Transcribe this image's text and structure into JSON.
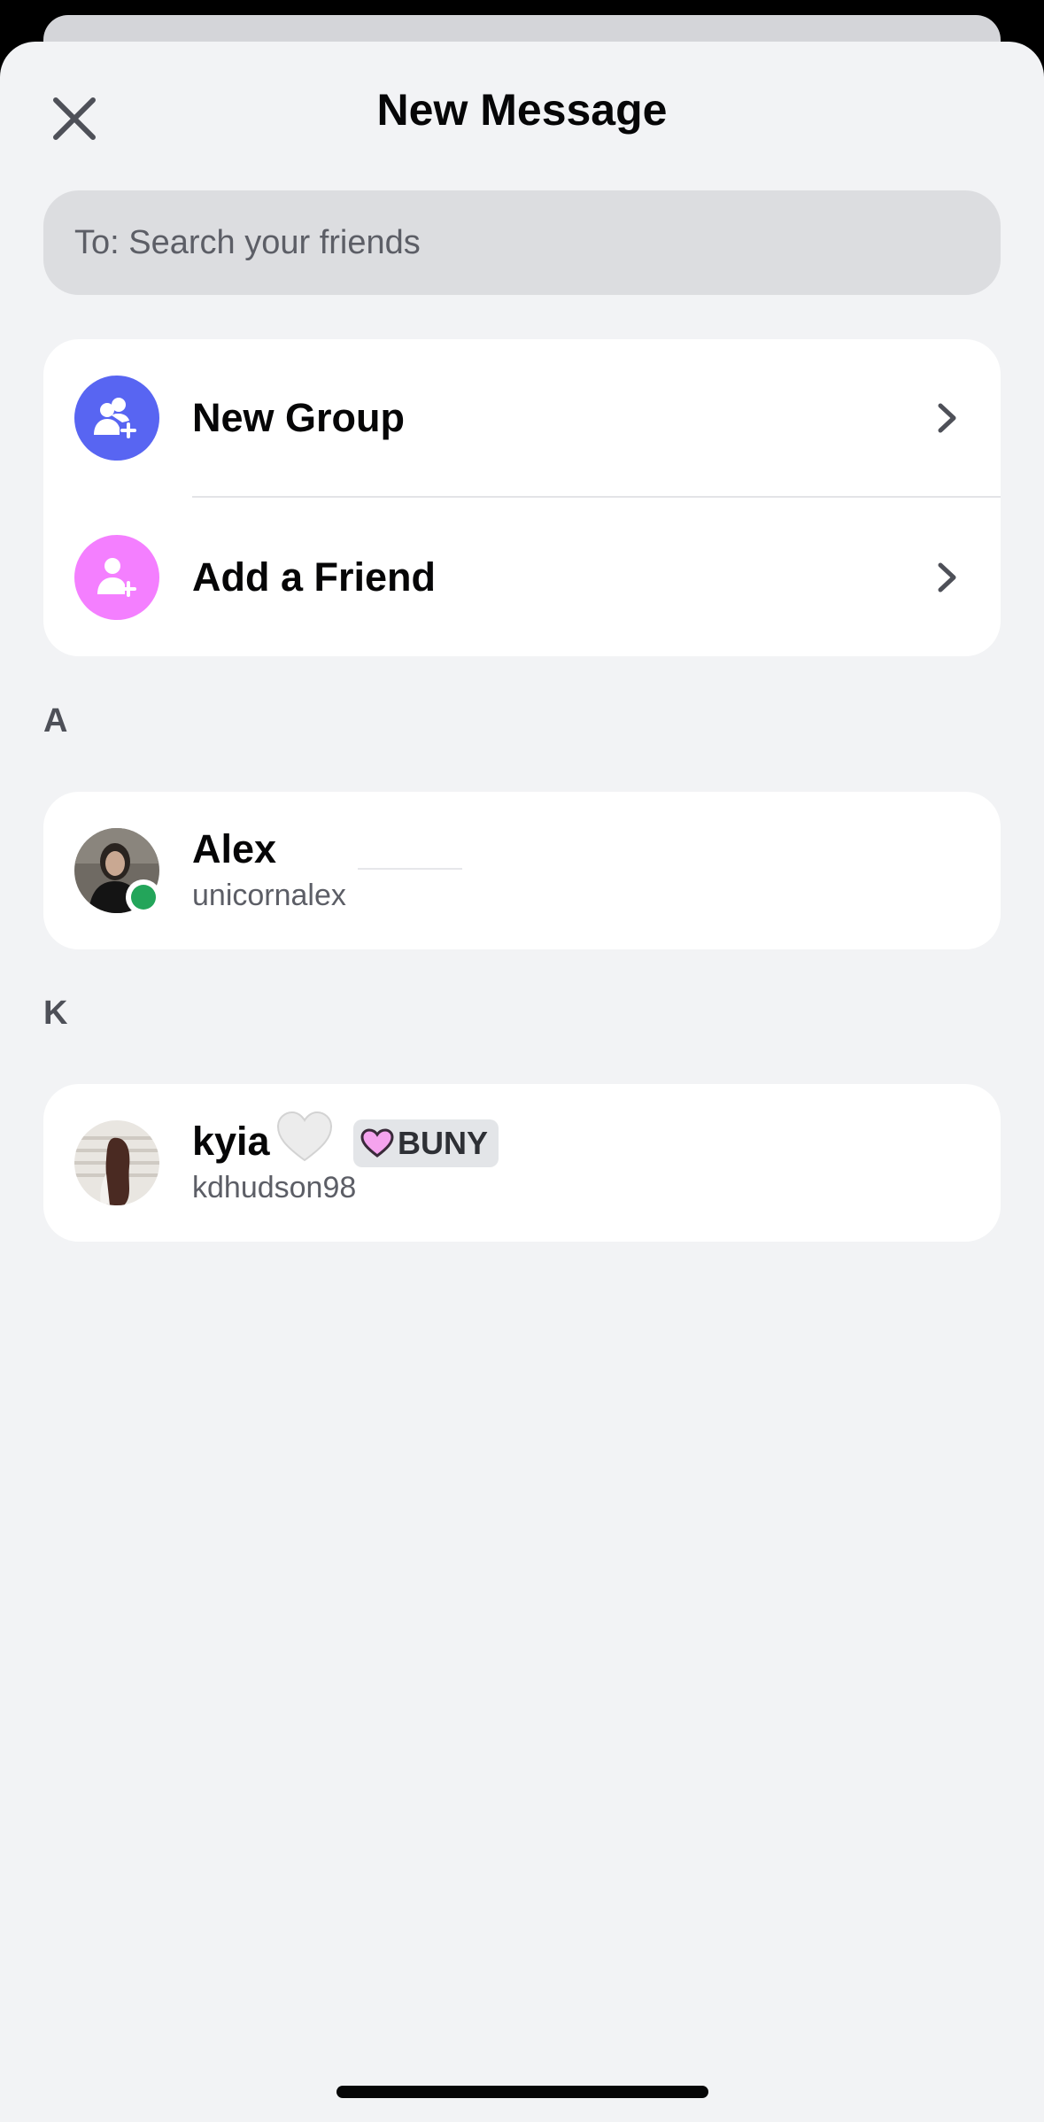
{
  "header": {
    "title": "New Message",
    "close_icon": "close-icon"
  },
  "search": {
    "placeholder": "To: Search your friends"
  },
  "actions": [
    {
      "label": "New Group",
      "icon": "group-add-icon",
      "color": "#5865f2"
    },
    {
      "label": "Add a Friend",
      "icon": "person-add-icon",
      "color": "#f47fff"
    }
  ],
  "sections": [
    {
      "letter": "A",
      "friends": [
        {
          "display_name": "Alex",
          "username": "unicornalex",
          "status": "online",
          "status_color": "#23a55a"
        }
      ]
    },
    {
      "letter": "K",
      "friends": [
        {
          "display_name": "kyia",
          "username": "kdhudson98",
          "emoji": "white-heart-icon",
          "tag": "BUNY",
          "tag_icon": "pink-heart-icon"
        }
      ]
    }
  ],
  "colors": {
    "sheet_bg": "#f2f3f5",
    "card_bg": "#ffffff",
    "blurple": "#5865f2",
    "pink": "#f47fff",
    "online": "#23a55a"
  }
}
